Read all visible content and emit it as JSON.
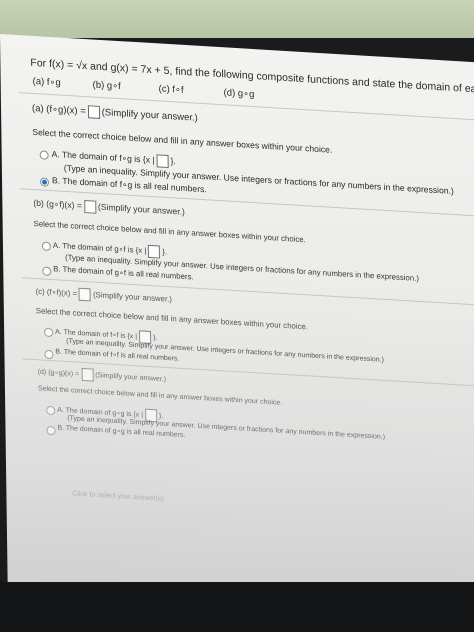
{
  "question": {
    "prompt": "For f(x) = √x and g(x) = 7x + 5, find the following composite functions and state the domain of each.",
    "parts": [
      "(a) f∘g",
      "(b) g∘f",
      "(c) f∘f",
      "(d) g∘g"
    ]
  },
  "instructions": {
    "simplify": "(Simplify your answer.)",
    "select_choice": "Select the correct choice below and fill in any answer boxes within your choice.",
    "type_inequality": "(Type an inequality. Simplify your answer. Use integers or fractions for any numbers in the expression.)"
  },
  "part_a": {
    "label": "(a) (f∘g)(x) =",
    "choice_a": "A. The domain of f∘g is {x |",
    "choice_a_end": "}.",
    "choice_b": "B. The domain of f∘g is all real numbers.",
    "selected": "B"
  },
  "part_b": {
    "label": "(b) (g∘f)(x) =",
    "choice_a": "A. The domain of g∘f is {x |",
    "choice_a_end": "}.",
    "choice_b": "B. The domain of g∘f is all real numbers."
  },
  "part_c": {
    "label": "(c) (f∘f)(x) =",
    "choice_a": "A. The domain of f∘f is {x |",
    "choice_a_end": "}.",
    "choice_b": "B. The domain of f∘f is all real numbers."
  },
  "part_d": {
    "label": "(d) (g∘g)(x) =",
    "choice_a": "A. The domain of g∘g is {x |",
    "choice_a_end": "}.",
    "choice_b": "B. The domain of g∘g is all real numbers."
  },
  "footer_hint": "Click to select your answer(s)."
}
